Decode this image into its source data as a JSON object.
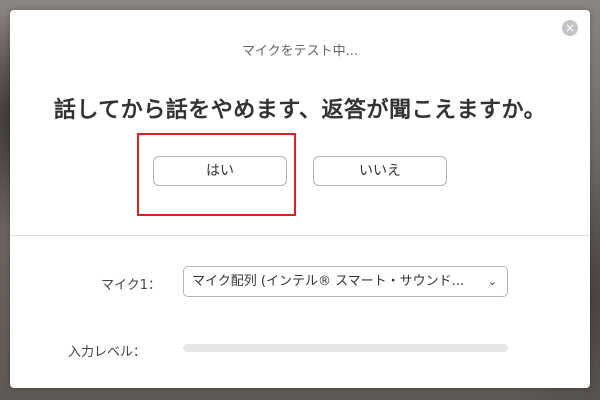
{
  "dialog": {
    "title": "マイクをテスト中...",
    "question": "話してから話をやめます、返答が聞こえますか。",
    "close_icon": "×",
    "buttons": {
      "yes_label": "はい",
      "no_label": "いいえ"
    },
    "microphone": {
      "label": "マイク1：",
      "selected": "マイク配列 (インテル® スマート・サウンド..."
    },
    "input_level": {
      "label": "入力レベル：",
      "level": 0
    }
  },
  "colors": {
    "highlight": "#e02020",
    "divider": "#dddddd"
  }
}
